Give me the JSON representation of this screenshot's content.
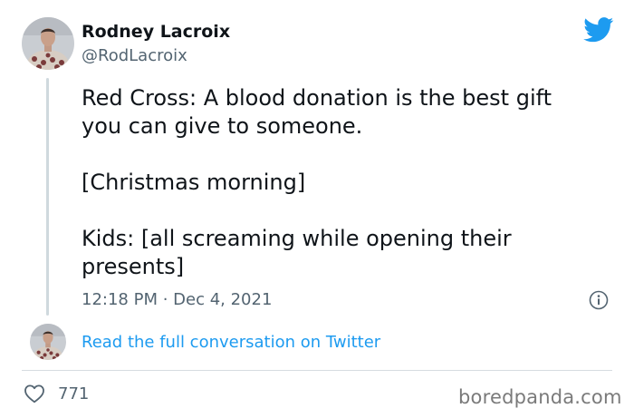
{
  "tweet": {
    "author": {
      "display_name": "Rodney Lacroix",
      "handle": "@RodLacroix",
      "avatar_icon": "user-avatar"
    },
    "text_lines": [
      "Red Cross: A blood donation is the best gift",
      "you can give to someone.",
      "[Christmas morning]",
      "Kids: [all screaming while opening their",
      "presents]"
    ],
    "timestamp": "12:18 PM · Dec 4, 2021",
    "read_conversation": "Read the full conversation on Twitter",
    "likes": "771"
  },
  "watermark": "boredpanda.com",
  "colors": {
    "twitter_blue": "#1d9bf0",
    "secondary_text": "#536471",
    "primary_text": "#0f1419",
    "thread_line": "#cfd9de"
  },
  "icons": {
    "brand": "twitter-bird-icon",
    "info": "info-icon",
    "like": "heart-icon"
  }
}
